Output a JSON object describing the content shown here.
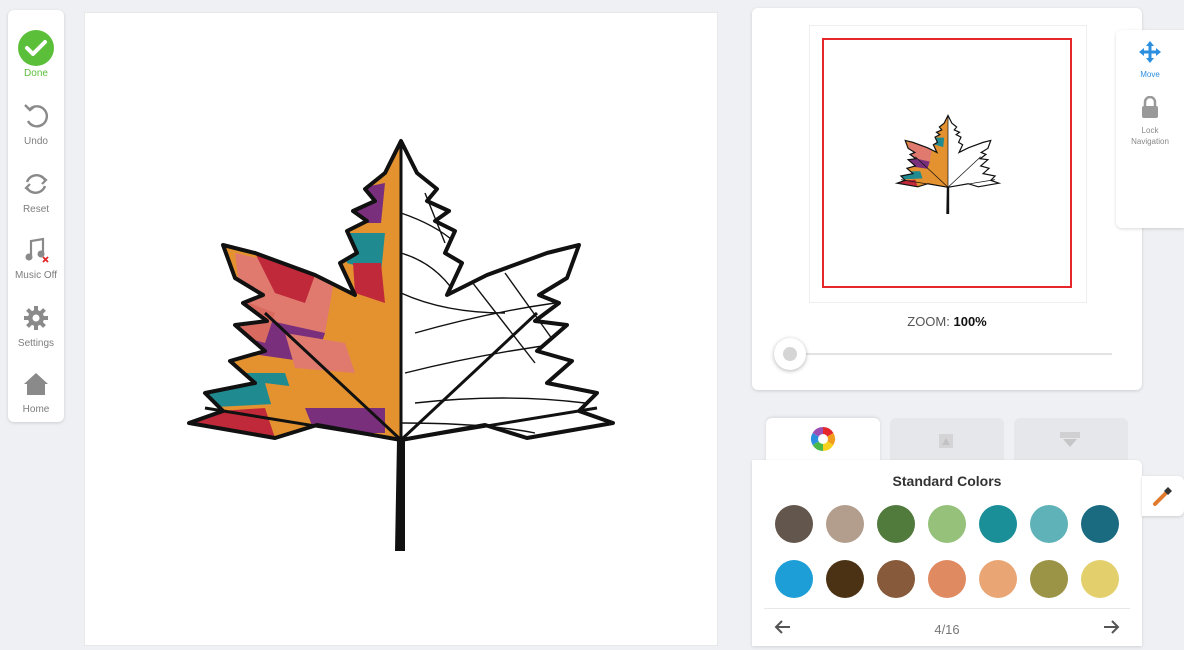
{
  "toolbar": {
    "done": "Done",
    "undo": "Undo",
    "reset": "Reset",
    "music": "Music Off",
    "settings": "Settings",
    "home": "Home"
  },
  "preview": {
    "zoom_label": "ZOOM:",
    "zoom_value": "100%",
    "zoom_level": 0
  },
  "side_tools": {
    "move": "Move",
    "lock_line1": "Lock",
    "lock_line2": "Navigation"
  },
  "palette": {
    "title": "Standard Colors",
    "page": "4/16",
    "colors": [
      "#63564c",
      "#b39e8d",
      "#517a3d",
      "#95c17a",
      "#1a8f98",
      "#5fb2b8",
      "#1a6a80",
      "#1d9ed6",
      "#4c3215",
      "#865a3b",
      "#e08a62",
      "#e9a674",
      "#9b9345",
      "#e3d06c"
    ]
  },
  "accent": "#2b8fe0",
  "done_color": "#5bbf3a",
  "viewport_color": "#e5272b"
}
